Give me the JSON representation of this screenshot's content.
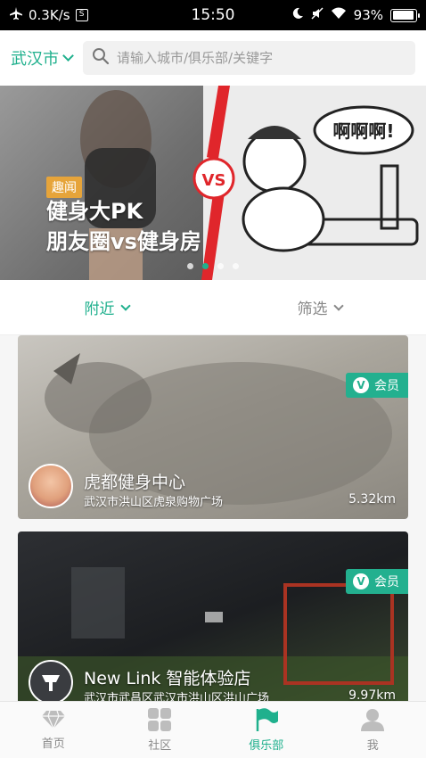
{
  "status_bar": {
    "speed": "0.3K/s",
    "time": "15:50",
    "battery": "93%",
    "icons": [
      "airplane-icon",
      "storage-box-icon",
      "moon-icon",
      "mute-icon",
      "wifi-icon",
      "battery-icon"
    ]
  },
  "header": {
    "city": "武汉市",
    "search_placeholder": "请输入城市/俱乐部/关键字"
  },
  "banner": {
    "tag": "趣闻",
    "title_line1": "健身大PK",
    "title_line2": "朋友圈vs健身房",
    "vs_label": "VS",
    "shout_text": "啊啊啊!",
    "dots_total": 4,
    "active_dot": 1
  },
  "filters": {
    "nearby": "附近",
    "filter": "筛选"
  },
  "clubs": [
    {
      "name": "虎都健身中心",
      "address": "武汉市洪山区虎泉购物广场",
      "distance": "5.32km",
      "badge": "会员"
    },
    {
      "name": "New Link 智能体验店",
      "address": "武汉市武昌区武汉市洪山区洪山广场",
      "distance": "9.97km",
      "badge": "会员"
    }
  ],
  "bottom_nav": [
    {
      "label": "首页",
      "icon": "diamond-icon"
    },
    {
      "label": "社区",
      "icon": "grid-icon"
    },
    {
      "label": "俱乐部",
      "icon": "flag-icon"
    },
    {
      "label": "我",
      "icon": "user-icon"
    }
  ],
  "colors": {
    "accent": "#1fb08d",
    "badge": "#23b08f",
    "tag": "#e6a43a",
    "inactive": "#8a8a8a"
  }
}
